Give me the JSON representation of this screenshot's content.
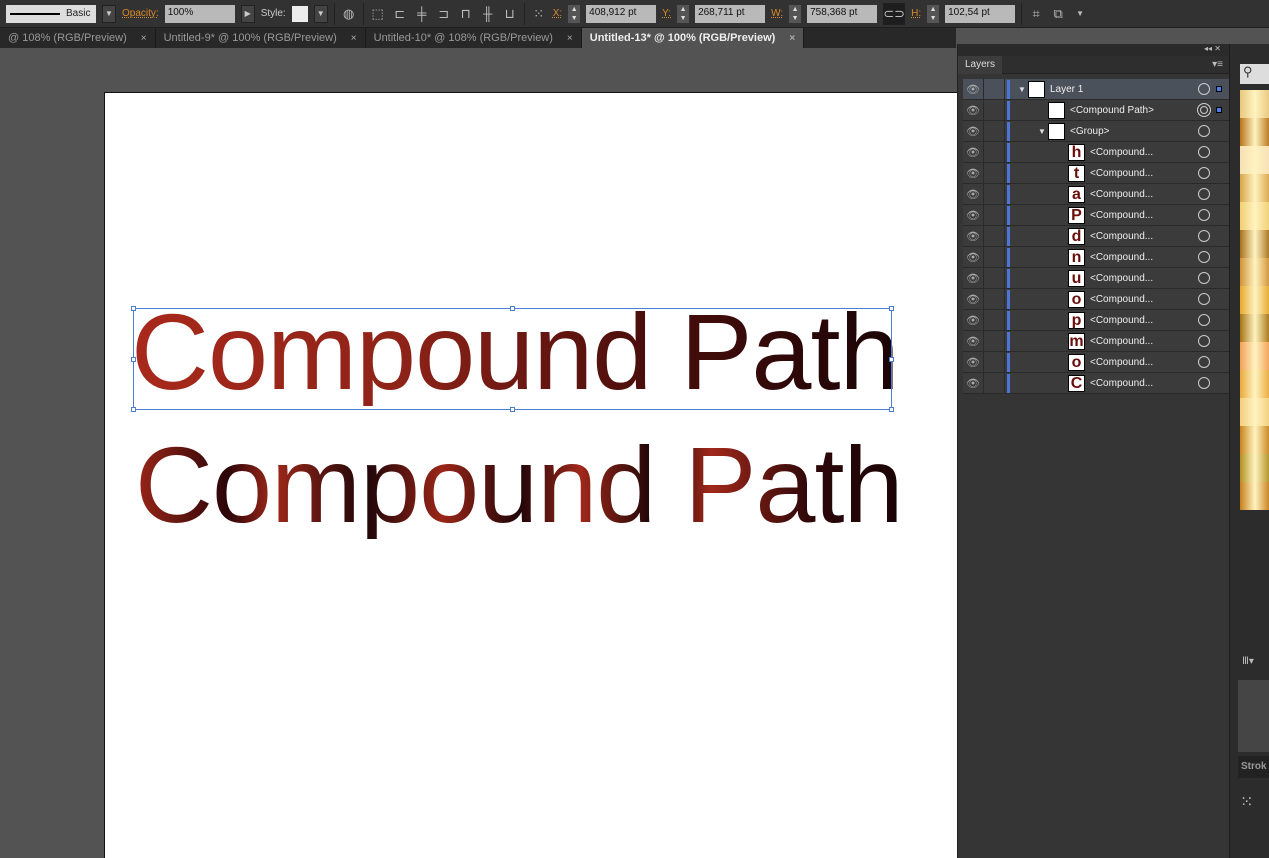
{
  "control_bar": {
    "stroke_style": "Basic",
    "opacity_label": "Opacity:",
    "opacity_value": "100%",
    "style_label": "Style:",
    "x_label": "X:",
    "x_value": "408,912 pt",
    "y_label": "Y:",
    "y_value": "268,711 pt",
    "w_label": "W:",
    "w_value": "758,368 pt",
    "h_label": "H:",
    "h_value": "102,54 pt"
  },
  "tabs": [
    {
      "label": "@ 108% (RGB/Preview)"
    },
    {
      "label": "Untitled-9* @ 100% (RGB/Preview)"
    },
    {
      "label": "Untitled-10* @ 108% (RGB/Preview)"
    },
    {
      "label": "Untitled-13* @ 100% (RGB/Preview)"
    }
  ],
  "tab_close": "×",
  "canvas": {
    "line1": "Compound Path",
    "line2": "Compound Path"
  },
  "layers_panel": {
    "title": "Layers",
    "rows": [
      {
        "name": "Layer 1",
        "thumb": ""
      },
      {
        "name": "<Compound Path>",
        "thumb": ""
      },
      {
        "name": "<Group>",
        "thumb": ""
      },
      {
        "name": "<Compound...",
        "thumb": "h"
      },
      {
        "name": "<Compound...",
        "thumb": "t"
      },
      {
        "name": "<Compound...",
        "thumb": "a"
      },
      {
        "name": "<Compound...",
        "thumb": "P"
      },
      {
        "name": "<Compound...",
        "thumb": "d"
      },
      {
        "name": "<Compound...",
        "thumb": "n"
      },
      {
        "name": "<Compound...",
        "thumb": "u"
      },
      {
        "name": "<Compound...",
        "thumb": "o"
      },
      {
        "name": "<Compound...",
        "thumb": "p"
      },
      {
        "name": "<Compound...",
        "thumb": "m"
      },
      {
        "name": "<Compound...",
        "thumb": "o"
      },
      {
        "name": "<Compound...",
        "thumb": "C"
      }
    ]
  },
  "side_panel": {
    "stroke_tab": "Strok"
  },
  "colors": {
    "layer_bar": "#4a74d8",
    "text_red": "#a8291b",
    "text_dark": "#1a0406"
  }
}
